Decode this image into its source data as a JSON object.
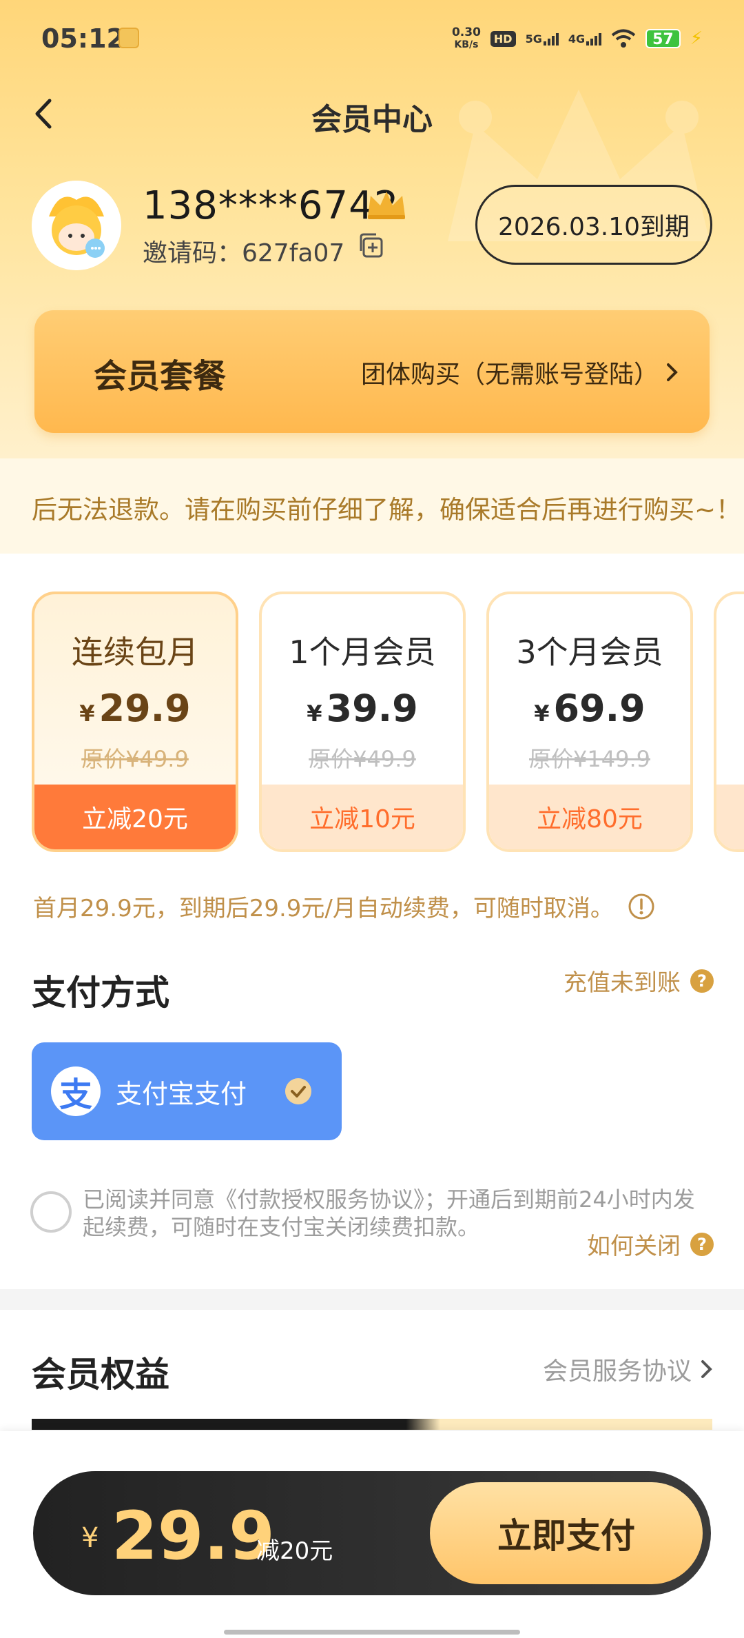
{
  "status_bar": {
    "time": "05:12",
    "net_speed_value": "0.30",
    "net_speed_unit": "KB/s",
    "hd": "HD",
    "sim1": "5G",
    "sim2": "4G",
    "battery": "57"
  },
  "header": {
    "title": "会员中心"
  },
  "user": {
    "phone": "138****6742",
    "invite_code": "邀请码：627fa07",
    "expire": "2026.03.10到期"
  },
  "package": {
    "title": "会员套餐",
    "group_buy": "团体购买（无需账号登陆）"
  },
  "notice": {
    "text": "后无法退款。请在购买前仔细了解，确保适合后再进行购买~！"
  },
  "plans": [
    {
      "name": "连续包月",
      "currency": "¥",
      "price": "29.9",
      "original": "原价¥49.9",
      "discount": "立减20元",
      "selected": true
    },
    {
      "name": "1个月会员",
      "currency": "¥",
      "price": "39.9",
      "original": "原价¥49.9",
      "discount": "立减10元",
      "selected": false
    },
    {
      "name": "3个月会员",
      "currency": "¥",
      "price": "69.9",
      "original": "原价¥149.9",
      "discount": "立减80元",
      "selected": false
    }
  ],
  "renew_note": "首月29.9元，到期后29.9元/月自动续费，可随时取消。",
  "payment": {
    "title": "支付方式",
    "recharge_issue": "充值未到账",
    "alipay_logo": "支",
    "alipay_label": "支付宝支付"
  },
  "agreement": {
    "text": "已阅读并同意《付款授权服务协议》；开通后到期前24小时内发起续费，可随时在支付宝关闭续费扣款。",
    "how_close": "如何关闭"
  },
  "benefits": {
    "title": "会员权益",
    "service_link": "会员服务协议"
  },
  "bottom_bar": {
    "currency": "¥",
    "amount": "29.9",
    "save": "减20元",
    "pay_button": "立即支付"
  },
  "colors": {
    "accent": "#ff7a3a",
    "gold_text": "#c0904a",
    "alipay_blue": "#5b95f7"
  }
}
